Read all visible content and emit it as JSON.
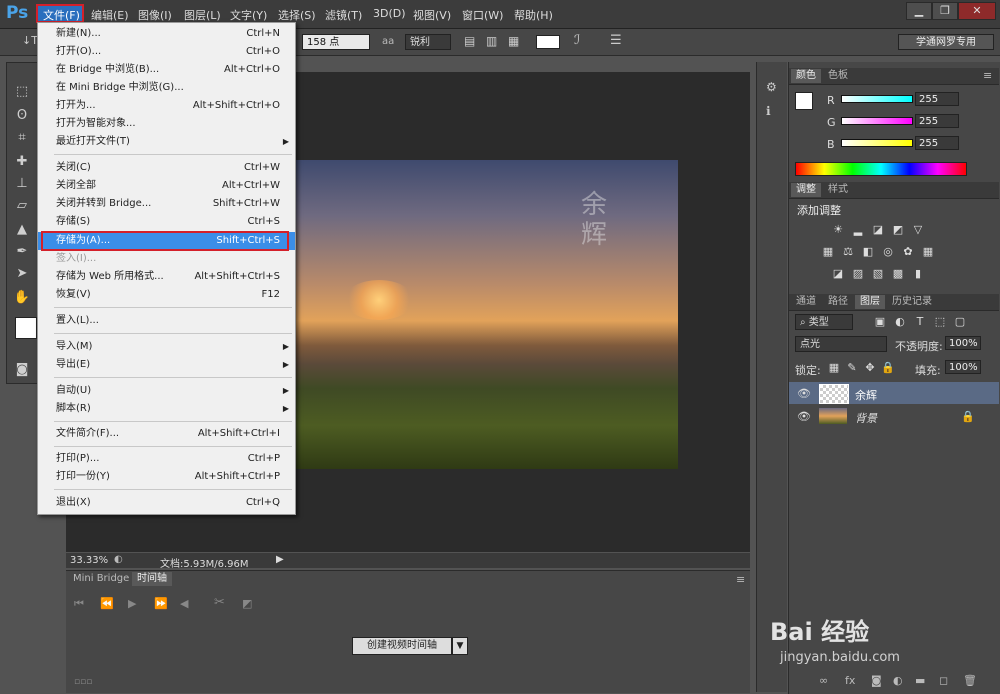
{
  "app": {
    "logo": "Ps"
  },
  "menubar": {
    "items": [
      "文件(F)",
      "编辑(E)",
      "图像(I)",
      "图层(L)",
      "文字(Y)",
      "选择(S)",
      "滤镜(T)",
      "3D(D)",
      "视图(V)",
      "窗口(W)",
      "帮助(H)"
    ]
  },
  "window_controls": {
    "minimize": "▁",
    "restore": "❐",
    "close": "✕"
  },
  "options": {
    "font_size": "158 点",
    "aa_icon": "aa",
    "aa_mode": "锐利",
    "workspace": "学通网罗专用"
  },
  "file_menu": {
    "items": [
      {
        "label": "新建(N)...",
        "shortcut": "Ctrl+N"
      },
      {
        "label": "打开(O)...",
        "shortcut": "Ctrl+O"
      },
      {
        "label": "在 Bridge 中浏览(B)...",
        "shortcut": "Alt+Ctrl+O"
      },
      {
        "label": "在 Mini Bridge 中浏览(G)...",
        "shortcut": ""
      },
      {
        "label": "打开为...",
        "shortcut": "Alt+Shift+Ctrl+O"
      },
      {
        "label": "打开为智能对象...",
        "shortcut": ""
      },
      {
        "label": "最近打开文件(T)",
        "shortcut": "",
        "submenu": true
      },
      {
        "label": "关闭(C)",
        "shortcut": "Ctrl+W"
      },
      {
        "label": "关闭全部",
        "shortcut": "Alt+Ctrl+W"
      },
      {
        "label": "关闭并转到 Bridge...",
        "shortcut": "Shift+Ctrl+W"
      },
      {
        "label": "存储(S)",
        "shortcut": "Ctrl+S"
      },
      {
        "label": "存储为(A)...",
        "shortcut": "Shift+Ctrl+S",
        "highlighted": true
      },
      {
        "label": "签入(I)...",
        "shortcut": "",
        "disabled": true
      },
      {
        "label": "存储为 Web 所用格式...",
        "shortcut": "Alt+Shift+Ctrl+S"
      },
      {
        "label": "恢复(V)",
        "shortcut": "F12"
      },
      {
        "label": "置入(L)...",
        "shortcut": ""
      },
      {
        "label": "导入(M)",
        "shortcut": "",
        "submenu": true
      },
      {
        "label": "导出(E)",
        "shortcut": "",
        "submenu": true
      },
      {
        "label": "自动(U)",
        "shortcut": "",
        "submenu": true
      },
      {
        "label": "脚本(R)",
        "shortcut": "",
        "submenu": true
      },
      {
        "label": "文件简介(F)...",
        "shortcut": "Alt+Shift+Ctrl+I"
      },
      {
        "label": "打印(P)...",
        "shortcut": "Ctrl+P"
      },
      {
        "label": "打印一份(Y)",
        "shortcut": "Alt+Shift+Ctrl+P"
      },
      {
        "label": "退出(X)",
        "shortcut": "Ctrl+Q"
      }
    ]
  },
  "document": {
    "watermark_text": "余辉",
    "zoom": "33.33%",
    "doc_size": "文档:5.93M/6.96M"
  },
  "timeline": {
    "tabs": [
      "Mini Bridge",
      "时间轴"
    ],
    "active_tab": 1,
    "create_button": "创建视频时间轴"
  },
  "color_panel": {
    "tabs": [
      "颜色",
      "色板"
    ],
    "channels": [
      {
        "name": "R",
        "value": "255",
        "gradient": "#00ffff"
      },
      {
        "name": "G",
        "value": "255",
        "gradient": "#ff00ff"
      },
      {
        "name": "B",
        "value": "255",
        "gradient": "#ffff00"
      }
    ]
  },
  "adjustments_panel": {
    "tabs": [
      "调整",
      "样式"
    ],
    "title": "添加调整"
  },
  "layers_panel": {
    "tabs": [
      "通道",
      "路径",
      "图层",
      "历史记录"
    ],
    "active_tab": 2,
    "filter_kind": "类型",
    "blend_mode": "点光",
    "opacity_label": "不透明度:",
    "opacity_value": "100%",
    "lock_label": "锁定:",
    "fill_label": "填充:",
    "fill_value": "100%",
    "layers": [
      {
        "name": "余辉",
        "selected": true
      },
      {
        "name": "背景",
        "locked": true
      }
    ]
  },
  "watermark_site": {
    "brand": "Bai 经验",
    "url": "jingyan.baidu.com"
  }
}
